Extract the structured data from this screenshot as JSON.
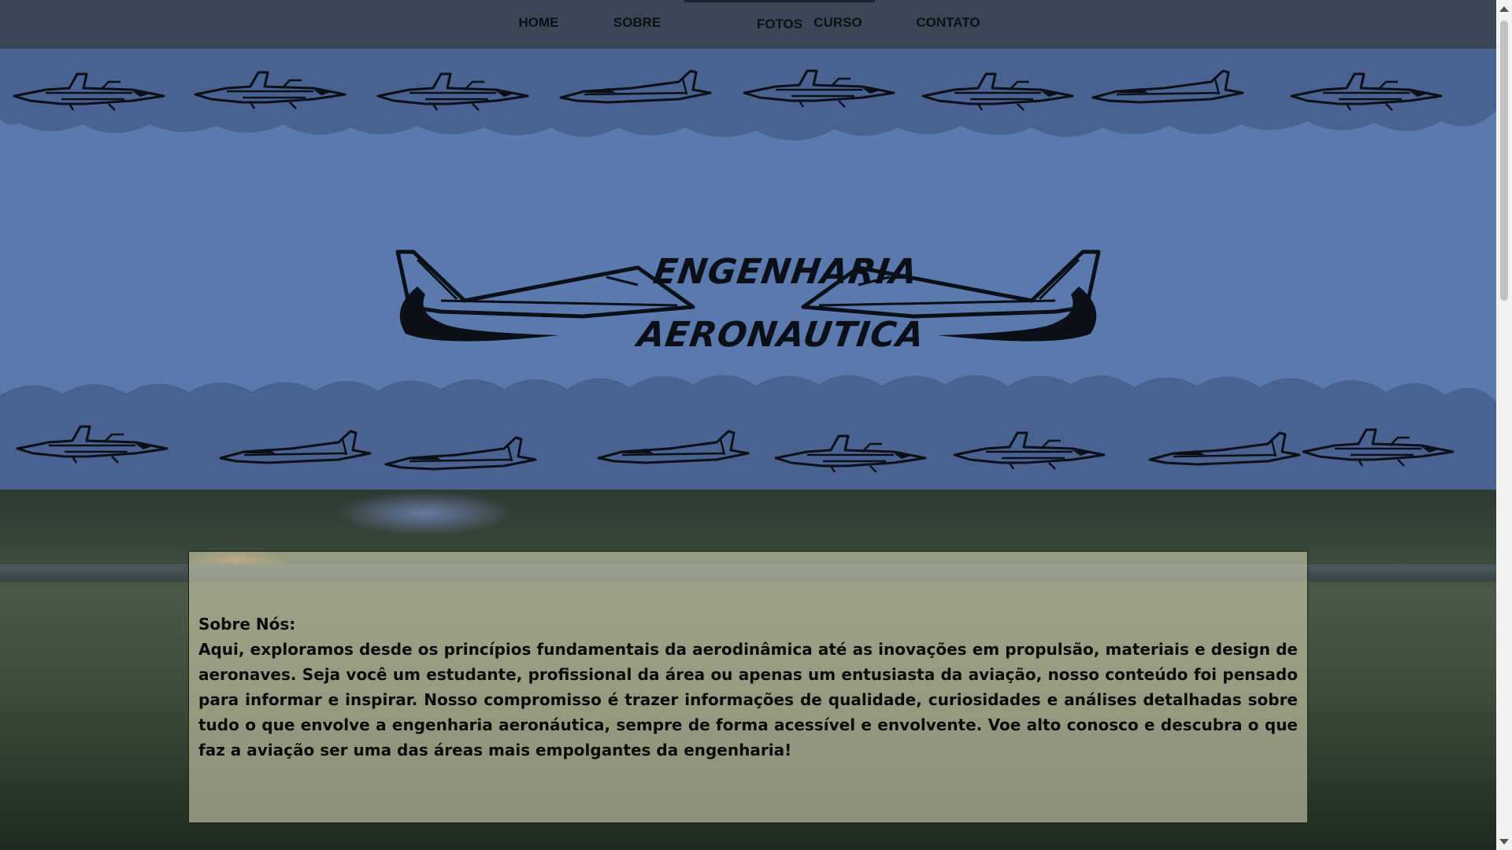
{
  "nav": {
    "items": [
      {
        "label": "HOME"
      },
      {
        "label": "SOBRE"
      },
      {
        "label": "FOTOS"
      },
      {
        "label": "CURSO"
      },
      {
        "label": "CONTATO"
      }
    ],
    "active_index": 2
  },
  "logo": {
    "line1": "ENGENHARIA",
    "line2": "AERONAUTICA"
  },
  "about": {
    "title": "Sobre Nós:",
    "body": "Aqui, exploramos desde os princípios fundamentais da aerodinâmica até as inovações em propulsão, materiais e design de aeronaves. Seja você um estudante, profissional da área ou apenas um entusiasta da aviação, nosso conteúdo foi pensado para informar e inspirar. Nosso compromisso é trazer informações de qualidade, curiosidades e análises detalhadas sobre tudo o que envolve a engenharia aeronáutica, sempre de forma acessível e envolvente. Voe alto conosco e descubra o que faz a aviação ser uma das áreas mais empolgantes da engenharia!"
  },
  "colors": {
    "nav_bg": "#3b4656",
    "banner_bg": "#5a7aae",
    "cloud": "#4a6290",
    "card_bg": "rgba(205,205,175,0.62)"
  },
  "icons": [
    "jet-silhouette-icon",
    "cloud-shape",
    "scroll-up-arrow-icon",
    "scroll-down-arrow-icon"
  ]
}
